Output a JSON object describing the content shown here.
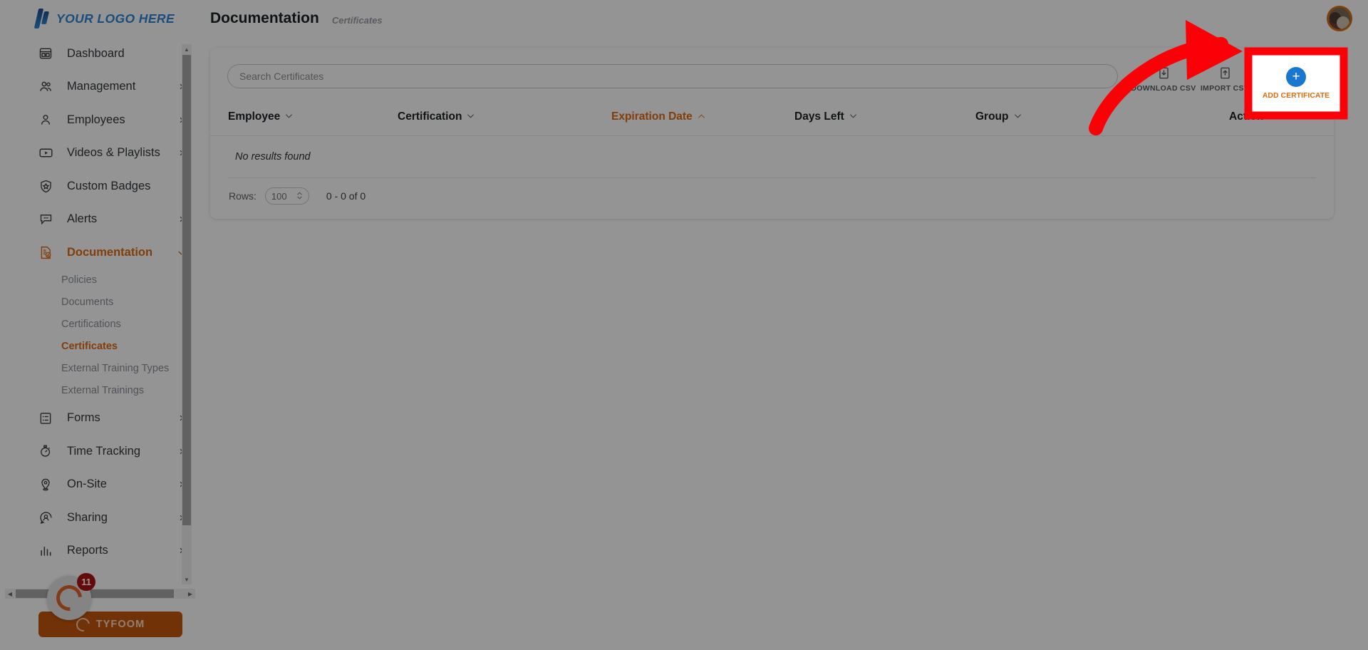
{
  "brand": {
    "logo_text": "YOUR LOGO HERE",
    "logo_icon": "double-slash-logo-icon",
    "accent_orange": "#e06c12",
    "accent_blue": "#1878cf",
    "logo_blue": "#2f86d4",
    "highlight_red": "#fb0007"
  },
  "topbar": {
    "title": "Documentation",
    "subtitle": "Certificates",
    "avatar_alt": "user-avatar"
  },
  "sidebar": {
    "items": [
      {
        "label": "Dashboard",
        "icon": "dashboard-icon",
        "expandable": false,
        "active": false
      },
      {
        "label": "Management",
        "icon": "people-icon",
        "expandable": true,
        "active": false
      },
      {
        "label": "Employees",
        "icon": "person-icon",
        "expandable": true,
        "active": false
      },
      {
        "label": "Videos & Playlists",
        "icon": "video-play-icon",
        "expandable": true,
        "active": false
      },
      {
        "label": "Custom Badges",
        "icon": "badge-shield-star-icon",
        "expandable": false,
        "active": false
      },
      {
        "label": "Alerts",
        "icon": "chat-bubble-icon",
        "expandable": true,
        "active": false
      },
      {
        "label": "Documentation",
        "icon": "document-check-icon",
        "expandable": true,
        "active": true
      },
      {
        "label": "Forms",
        "icon": "checklist-icon",
        "expandable": true,
        "active": false
      },
      {
        "label": "Time Tracking",
        "icon": "stopwatch-icon",
        "expandable": true,
        "active": false
      },
      {
        "label": "On-Site",
        "icon": "map-pin-icon",
        "expandable": true,
        "active": false
      },
      {
        "label": "Sharing",
        "icon": "share-person-icon",
        "expandable": true,
        "active": false
      },
      {
        "label": "Reports",
        "icon": "bar-chart-icon",
        "expandable": true,
        "active": false
      }
    ],
    "documentation_subitems": [
      {
        "label": "Policies",
        "active": false
      },
      {
        "label": "Documents",
        "active": false
      },
      {
        "label": "Certifications",
        "active": false
      },
      {
        "label": "Certificates",
        "active": true
      },
      {
        "label": "External Training Types",
        "active": false
      },
      {
        "label": "External Trainings",
        "active": false
      }
    ],
    "tyfoom": {
      "label": "TYFOOM",
      "badge_count": "11",
      "icon": "tyfoom-swirl-icon"
    },
    "scrollbar": {
      "up_arrow_icon": "scroll-up-arrow-icon",
      "down_arrow_icon": "scroll-down-arrow-icon",
      "left_arrow_icon": "scroll-left-arrow-icon",
      "right_arrow_icon": "scroll-right-arrow-icon"
    }
  },
  "toolbar": {
    "search_placeholder": "Search Certificates",
    "search_value": "",
    "download_csv_label": "DOWNLOAD CSV",
    "download_csv_icon": "download-icon",
    "import_csv_label": "IMPORT CSV",
    "import_csv_icon": "upload-icon",
    "add_certificate_label": "ADD CERTIFICATE",
    "add_certificate_icon": "plus-icon"
  },
  "table": {
    "columns": [
      {
        "label": "Employee",
        "sort": "desc",
        "sorted": false
      },
      {
        "label": "Certification",
        "sort": "desc",
        "sorted": false
      },
      {
        "label": "Expiration Date",
        "sort": "asc",
        "sorted": true
      },
      {
        "label": "Days Left",
        "sort": "desc",
        "sorted": false
      },
      {
        "label": "Group",
        "sort": "desc",
        "sorted": false
      },
      {
        "label": "Action",
        "sort": "",
        "sorted": false
      }
    ],
    "rows": [],
    "empty_message": "No results found"
  },
  "pagination": {
    "rows_label": "Rows:",
    "rows_value": "100",
    "range_text": "0 - 0 of 0",
    "stepper_icon": "up-down-chevron-icon"
  },
  "annotation": {
    "arrow_icon": "curved-red-arrow-icon",
    "highlight_target": "add-certificate-button"
  }
}
